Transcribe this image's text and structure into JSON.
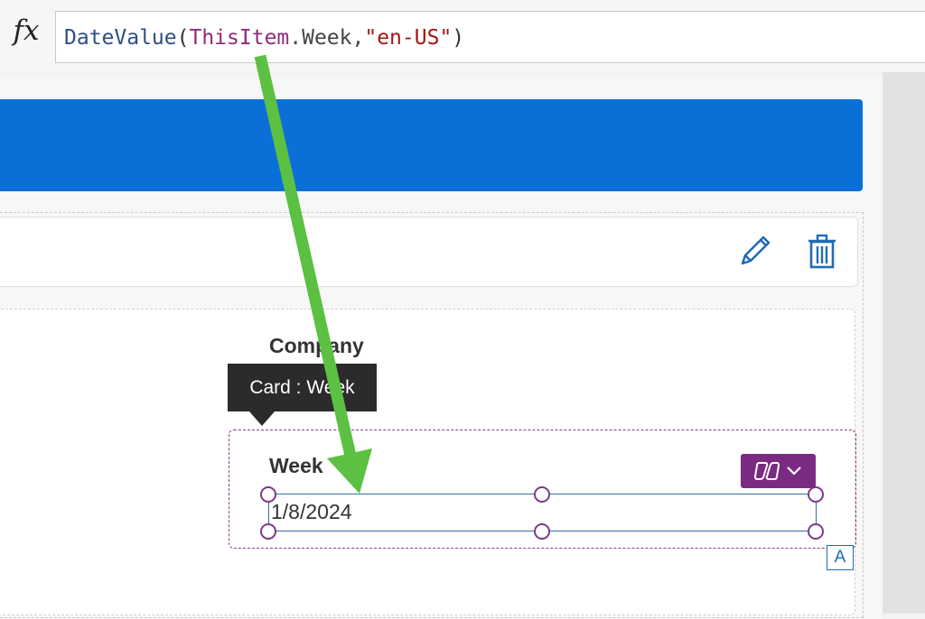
{
  "formula_bar": {
    "fx_label": "fx",
    "tokens": {
      "fn": "DateValue",
      "open": "(",
      "ident": "ThisItem",
      "dot_prop": ".Week,",
      "str": "\"en-US\"",
      "close": ")"
    }
  },
  "gallery": {
    "edit_icon": "pencil-icon",
    "delete_icon": "trash-icon"
  },
  "form": {
    "company_label": "Company",
    "tooltip": "Card : Week",
    "week_label": "Week",
    "week_value": "1/8/2024",
    "badge": "A"
  },
  "colors": {
    "header_blue": "#0a70d8",
    "accent_purple": "#7b2a82",
    "arrow_green": "#5cc043",
    "icon_blue": "#1f6bb5"
  }
}
